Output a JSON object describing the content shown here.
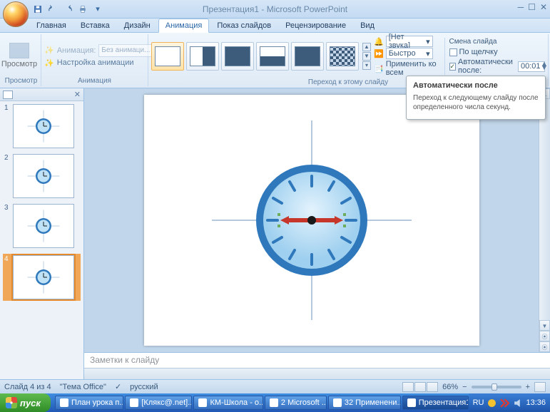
{
  "title": "Презентация1 - Microsoft PowerPoint",
  "qat": {
    "save": "save-icon",
    "undo": "undo-icon",
    "redo": "redo-icon",
    "qprint": "quickprint-icon"
  },
  "tabs": [
    "Главная",
    "Вставка",
    "Дизайн",
    "Анимация",
    "Показ слайдов",
    "Рецензирование",
    "Вид"
  ],
  "active_tab": 3,
  "ribbon": {
    "preview_label": "Просмотр",
    "preview_group": "Просмотр",
    "anim_label": "Анимация:",
    "anim_value": "Без анимаци...",
    "anim_custom": "Настройка анимации",
    "anim_group": "Анимация",
    "sound_label": "🔊",
    "sound_value": "[Нет звука]",
    "speed_label": "⏱",
    "speed_value": "Быстро",
    "apply_all": "Применить ко всем",
    "transition_group": "Переход к этому слайду",
    "advance_title": "Смена слайда",
    "on_click": "По щелчку",
    "auto_after": "Автоматически после:",
    "auto_value": "00:01"
  },
  "tooltip": {
    "title": "Автоматически после",
    "body": "Переход к следующему слайду после определенного числа секунд."
  },
  "slides": [
    1,
    2,
    3,
    4
  ],
  "selected_slide": 4,
  "notes_placeholder": "Заметки к слайду",
  "status": {
    "slide": "Слайд 4 из 4",
    "theme": "\"Тема Office\"",
    "lang": "русский",
    "zoom": "66%"
  },
  "taskbar": {
    "start": "пуск",
    "items": [
      "План урока п...",
      "[Клякс@.net]...",
      "КМ-Школа - о...",
      "2 Microsoft ...",
      "32 Применени...",
      "Презентация1"
    ],
    "active_item": 5,
    "lang": "RU",
    "time": "13:36"
  }
}
